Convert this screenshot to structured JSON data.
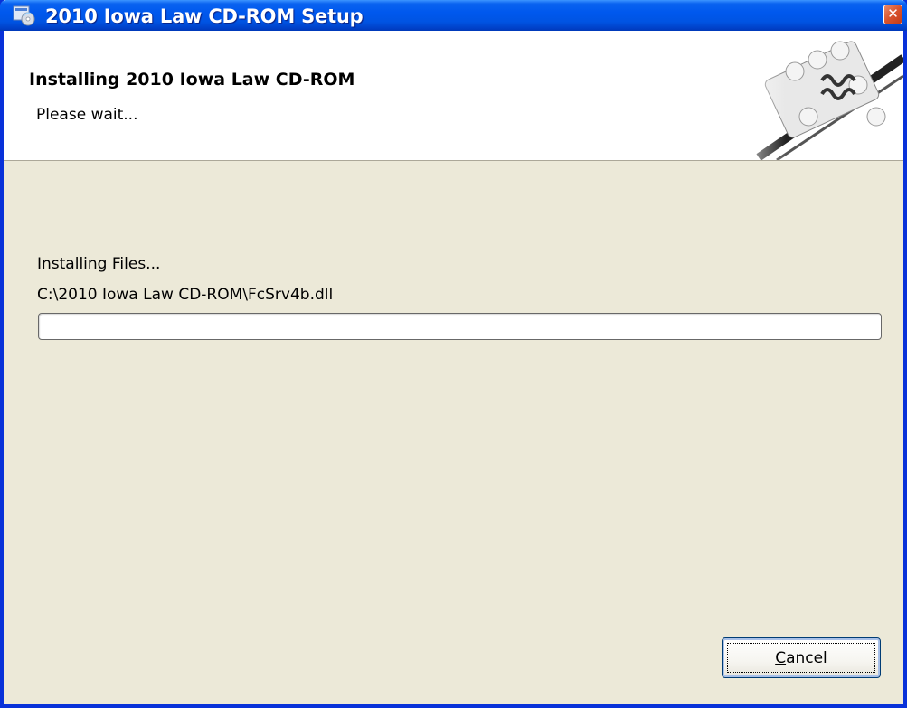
{
  "window": {
    "title": "2010 Iowa Law CD-ROM Setup",
    "close_glyph": "✕"
  },
  "banner": {
    "title": "Installing 2010 Iowa Law CD-ROM",
    "subtitle": "Please wait..."
  },
  "status": {
    "label": "Installing Files...",
    "current_file": "C:\\2010 Iowa Law CD-ROM\\FcSrv4b.dll",
    "progress_percent": 0
  },
  "buttons": {
    "cancel_accel": "C",
    "cancel_rest": "ancel"
  },
  "colors": {
    "titlebar": "#0054e3",
    "dialog_bg": "#ece9d8",
    "frame": "#0831d9"
  }
}
